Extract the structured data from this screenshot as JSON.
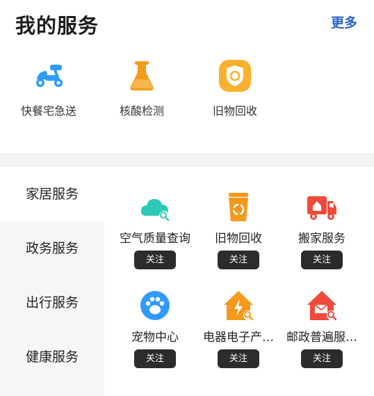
{
  "header": {
    "title": "我的服务",
    "more_label": "更多"
  },
  "my_services": [
    {
      "label": "快餐宅急送",
      "icon": "scooter-icon"
    },
    {
      "label": "核酸检测",
      "icon": "flask-icon"
    },
    {
      "label": "旧物回收",
      "icon": "shield-recycle-icon"
    }
  ],
  "categories": [
    {
      "label": "家居服务",
      "active": true
    },
    {
      "label": "政务服务"
    },
    {
      "label": "出行服务"
    },
    {
      "label": "健康服务"
    }
  ],
  "cards": [
    {
      "name": "空气质量查询",
      "icon": "cloud-search-icon",
      "follow": "关注"
    },
    {
      "name": "旧物回收",
      "icon": "recycle-bin-icon",
      "follow": "关注"
    },
    {
      "name": "搬家服务",
      "icon": "moving-truck-icon",
      "follow": "关注"
    },
    {
      "name": "宠物中心",
      "icon": "paw-icon",
      "follow": "关注"
    },
    {
      "name": "电器电子产…",
      "icon": "electric-house-icon",
      "follow": "关注"
    },
    {
      "name": "邮政普遍服…",
      "icon": "mail-house-icon",
      "follow": "关注"
    }
  ],
  "colors": {
    "accent_blue": "#2a62c9",
    "orange": "#f39a1c",
    "red": "#ef4a3c",
    "teal": "#2ec9b6",
    "sky": "#2f9bff",
    "follow_bg": "#2c2c2c"
  }
}
